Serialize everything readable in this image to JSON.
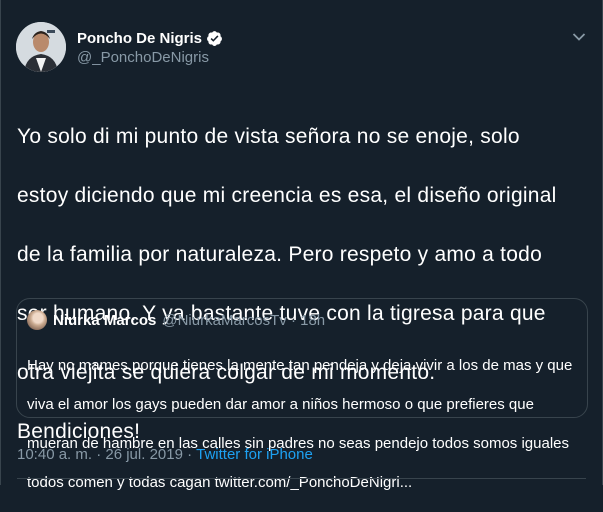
{
  "author": {
    "display_name": "Poncho De Nigris",
    "handle": "@_PonchoDeNigris",
    "verified": true,
    "avatar_icon": "profile-photo"
  },
  "menu_icon": "chevron-down-icon",
  "tweet_lines": [
    "Yo solo di mi punto de vista señora no se enoje, solo",
    "estoy diciendo que mi creencia es esa, el diseño original",
    "de la familia por naturaleza. Pero respeto y amo a todo",
    "ser humano. Y ya bastante tuve con la tigresa para que",
    "otra viejita se quiera colgar de mi momento.",
    "Bendiciones!"
  ],
  "quoted_tweet": {
    "name": "Niurka Marcos",
    "handle_time": "@NiurkaMarcosTv · 18h",
    "lines": [
      "Hay no mames porque tienes la mente tan pendeja y deja vivir a los de mas y que",
      "viva el amor los gays pueden dar amor a niños hermoso o que prefieres que",
      "mueran de hambre en las calles sin padres no seas pendejo todos somos iguales",
      "todos comen y todas cagan twitter.com/_PonchoDeNigri..."
    ]
  },
  "timestamp": "10:40 a. m. · 26 jul. 2019 ·",
  "source": "Twitter for iPhone",
  "colors": {
    "background": "#15202b",
    "text": "#ffffff",
    "muted": "#8899a6",
    "accent": "#1da1f2",
    "border": "#38444d"
  }
}
